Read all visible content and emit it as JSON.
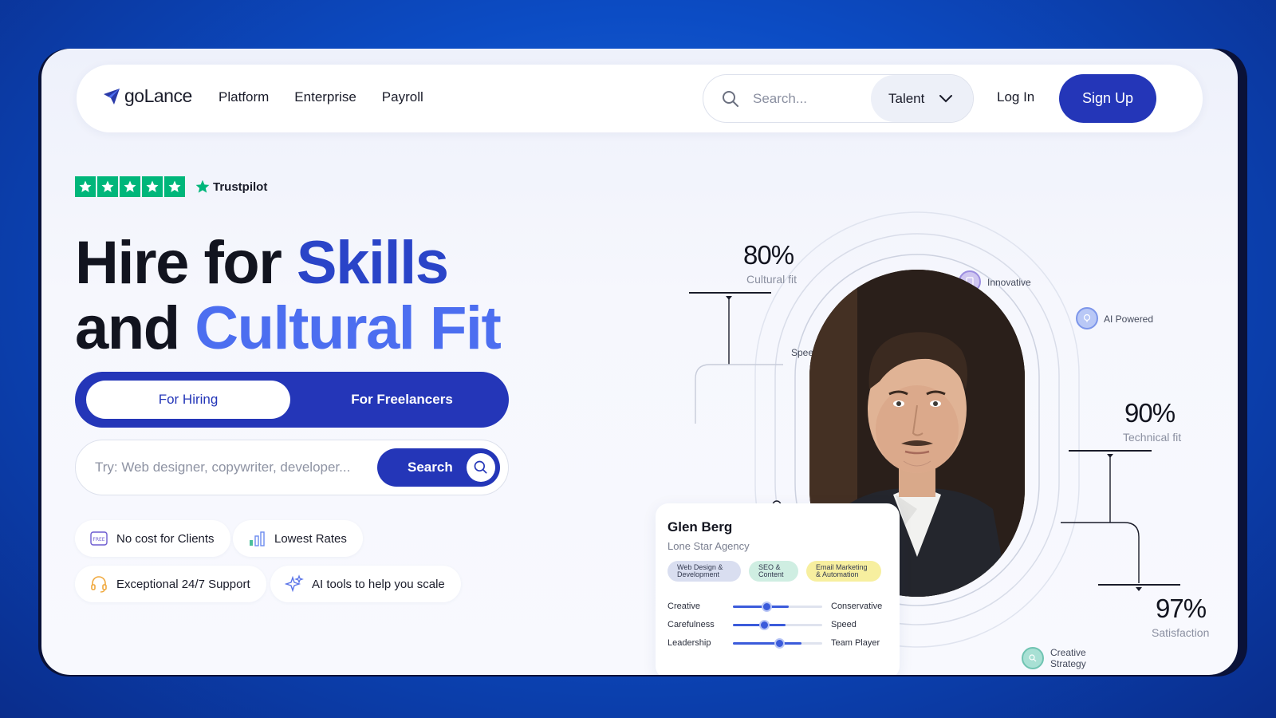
{
  "nav": {
    "logo": "goLance",
    "links": [
      "Platform",
      "Enterprise",
      "Payroll"
    ],
    "search_placeholder": "Search...",
    "talent_label": "Talent",
    "login": "Log In",
    "signup": "Sign Up"
  },
  "trustpilot": {
    "label": "Trustpilot",
    "stars": 5
  },
  "hero": {
    "line1_dark": "Hire for ",
    "line1_blue": "Skills",
    "line2_dark": "and ",
    "line2_blue": "Cultural Fit",
    "toggle_active": "For Hiring",
    "toggle_other": "For Freelancers",
    "search_placeholder": "Try: Web designer, copywriter, developer...",
    "search_button": "Search"
  },
  "features": [
    {
      "icon": "free-badge-icon",
      "label": "No cost for Clients"
    },
    {
      "icon": "bar-chart-icon",
      "label": "Lowest Rates"
    },
    {
      "icon": "headset-icon",
      "label": "Exceptional 24/7 Support"
    },
    {
      "icon": "sparkle-icon",
      "label": "AI tools to help you scale"
    }
  ],
  "stats": [
    {
      "value": "80%",
      "label": "Cultural fit"
    },
    {
      "value": "90%",
      "label": "Technical fit"
    },
    {
      "value": "97%",
      "label": "Satisfaction"
    }
  ],
  "orbit_tags": [
    "Innovative",
    "AI Powered",
    "Speed",
    "Creative Strategy"
  ],
  "profile": {
    "name": "Glen Berg",
    "org": "Lone Star Agency",
    "chips": [
      {
        "label": "Web Design & Development",
        "color": "#d9def0"
      },
      {
        "label": "SEO & Content",
        "color": "#cfeee2"
      },
      {
        "label": "Email Marketing & Automation",
        "color": "#f7ef9f"
      }
    ],
    "traits": [
      {
        "left": "Creative",
        "right": "Conservative",
        "level": 0.38
      },
      {
        "left": "Carefulness",
        "right": "Speed",
        "level": 0.35
      },
      {
        "left": "Leadership",
        "right": "Team Player",
        "level": 0.52
      }
    ]
  },
  "colors": {
    "brand": "#2436b8",
    "accent": "#4c6ef0",
    "trustpilot": "#00b67a"
  }
}
